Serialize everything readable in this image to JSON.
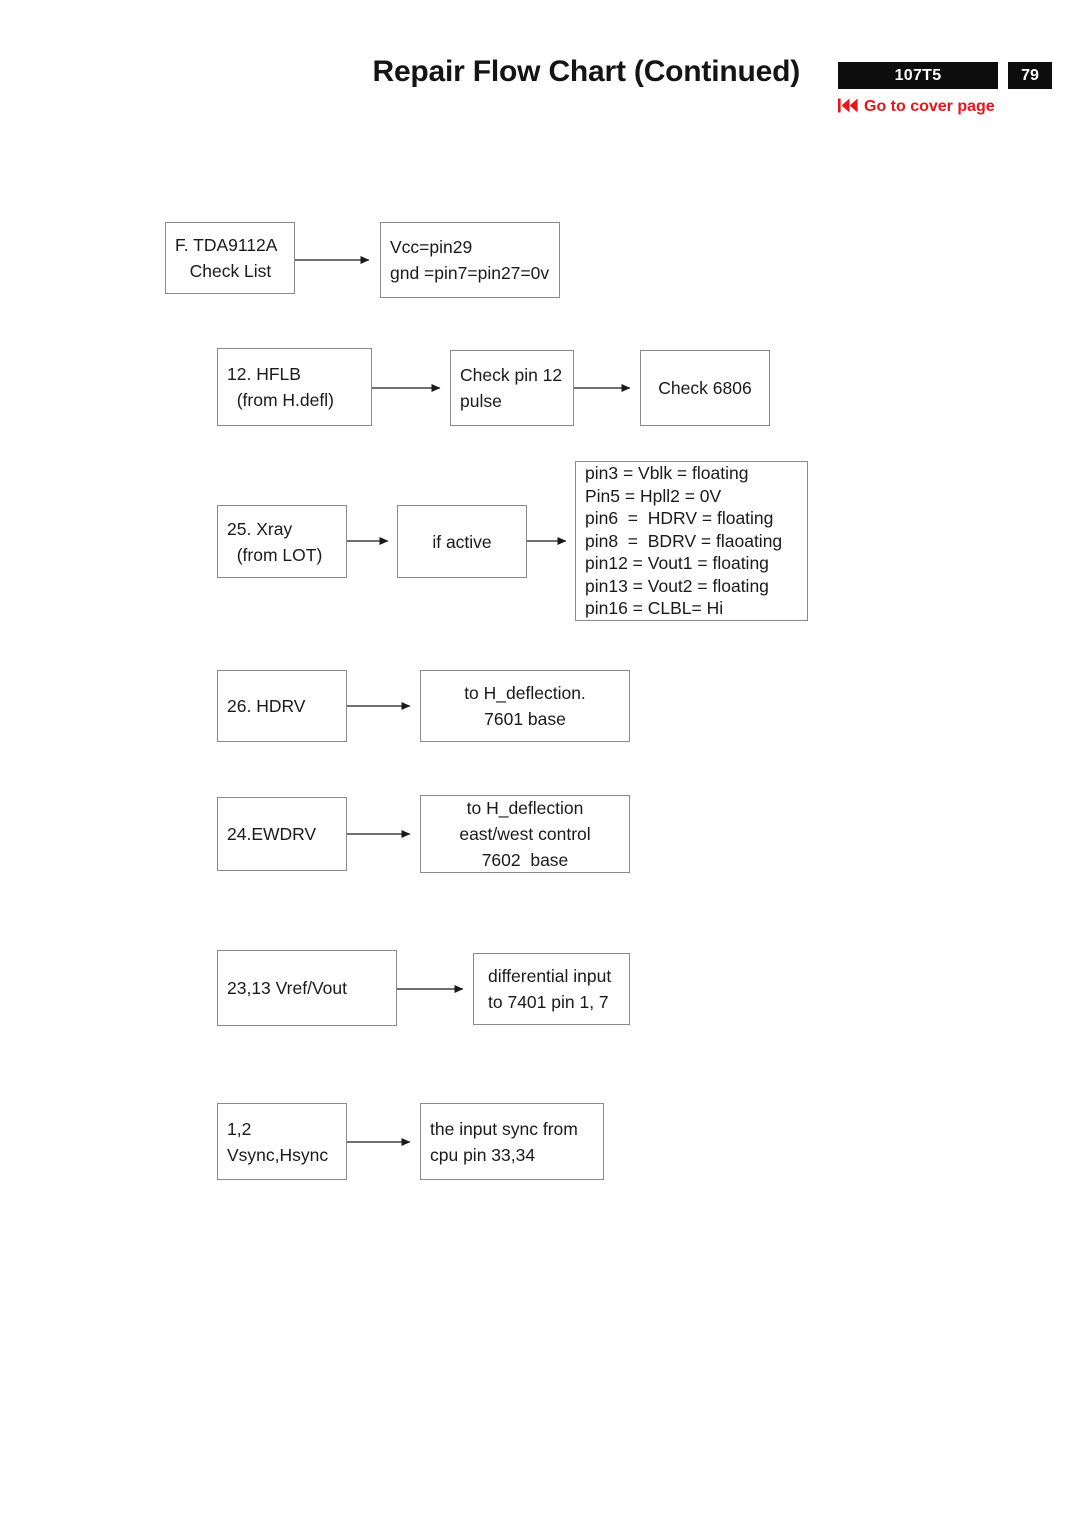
{
  "header": {
    "title": "Repair Flow Chart (Continued)",
    "model_badge": "107T5",
    "page_badge": "79",
    "cover_link": "Go to cover page",
    "link_color": "#e8161b",
    "badge_bg": "#0d0d0d"
  },
  "flow": {
    "rows": [
      {
        "id": "row-tda9112a",
        "nodes": [
          {
            "name": "node-tda9112a-check-list",
            "lines": [
              "F. TDA9112A",
              "   Check List"
            ]
          },
          {
            "name": "node-vcc-gnd",
            "lines": [
              "Vcc=pin29",
              "gnd =pin7=pin27=0v"
            ]
          }
        ]
      },
      {
        "id": "row-hflb",
        "nodes": [
          {
            "name": "node-hflb",
            "lines": [
              "12. HFLB",
              "  (from H.defl)"
            ]
          },
          {
            "name": "node-check-pin12-pulse",
            "lines": [
              "Check pin 12",
              "pulse"
            ]
          },
          {
            "name": "node-check-6806",
            "lines": [
              "Check 6806"
            ]
          }
        ]
      },
      {
        "id": "row-xray",
        "nodes": [
          {
            "name": "node-xray",
            "lines": [
              "25. Xray",
              "  (from LOT)"
            ]
          },
          {
            "name": "node-if-active",
            "lines": [
              "if active"
            ]
          },
          {
            "name": "node-pin-states",
            "lines": [
              "pin3 = Vblk = floating",
              "Pin5 = Hpll2 = 0V",
              "pin6  =  HDRV = floating",
              "pin8  =  BDRV = flaoating",
              "pin12 = Vout1 = floating",
              "pin13 = Vout2 = floating",
              "pin16 = CLBL= Hi"
            ]
          }
        ]
      },
      {
        "id": "row-hdrv",
        "nodes": [
          {
            "name": "node-hdrv",
            "lines": [
              "26. HDRV"
            ]
          },
          {
            "name": "node-hdeflection-7601",
            "lines": [
              "to H_deflection.",
              "7601 base"
            ]
          }
        ]
      },
      {
        "id": "row-ewdrv",
        "nodes": [
          {
            "name": "node-ewdrv",
            "lines": [
              "24.EWDRV"
            ]
          },
          {
            "name": "node-hdeflection-ew-7602",
            "lines": [
              "to H_deflection",
              "east/west control",
              "7602  base"
            ]
          }
        ]
      },
      {
        "id": "row-vref",
        "nodes": [
          {
            "name": "node-vref-vout",
            "lines": [
              "23,13 Vref/Vout"
            ]
          },
          {
            "name": "node-differential-input-7401",
            "lines": [
              "differential input",
              "to 7401 pin 1, 7"
            ]
          }
        ]
      },
      {
        "id": "row-sync",
        "nodes": [
          {
            "name": "node-vsync-hsync",
            "lines": [
              "1,2",
              "Vsync,Hsync"
            ]
          },
          {
            "name": "node-input-sync-cpu",
            "lines": [
              "the input sync from",
              "cpu pin 33,34"
            ]
          }
        ]
      }
    ]
  }
}
